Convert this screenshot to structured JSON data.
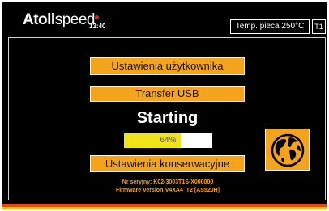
{
  "header": {
    "brand_bold": "Atoll",
    "brand_regular": "speed",
    "clock": "13:40",
    "temperature_label": "Temp. pieca 250°C",
    "zone_label": "T1"
  },
  "menu": {
    "user_settings_label": "Ustawienia użytkownika",
    "usb_transfer_label": "Transfer USB",
    "maintenance_settings_label": "Ustawienia konserwacyjne"
  },
  "status": {
    "text": "Starting",
    "progress_percent": 64,
    "progress_label": "64%"
  },
  "device_info": {
    "serial_line": "Nr seryjny: K02-3003T1S-X000000",
    "firmware_line": "Firmware Version:V4XA4_T2 [AS520H]"
  },
  "icons": {
    "language": "globe-icon",
    "alarm": "red-dot-indicator"
  },
  "colors": {
    "accent_orange": "#f4a41c",
    "progress_yellow": "#f0e41a",
    "background": "#000000",
    "alarm_red": "#e02020"
  }
}
